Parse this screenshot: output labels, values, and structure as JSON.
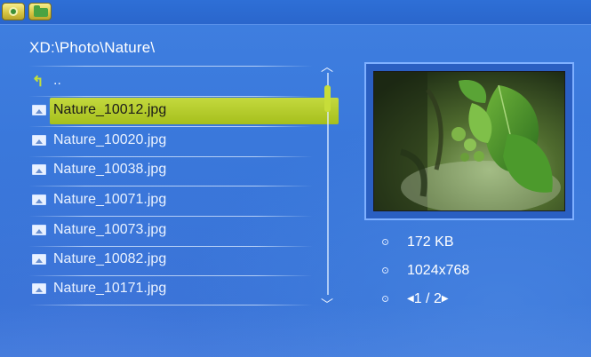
{
  "toolbar": {
    "icons": [
      "settings-icon",
      "folder-icon"
    ]
  },
  "browser": {
    "path": "XD:\\Photo\\Nature\\",
    "parent": "..",
    "files": [
      "Nature_10012.jpg",
      "Nature_10020.jpg",
      "Nature_10038.jpg",
      "Nature_10071.jpg",
      "Nature_10073.jpg",
      "Nature_10082.jpg",
      "Nature_10171.jpg"
    ],
    "selected_index": 0
  },
  "scrollbar": {
    "up_glyph": "^",
    "down_glyph": "v"
  },
  "info": {
    "size": "172 KB",
    "resolution": "1024x768",
    "page": "1 / 2",
    "page_prev": "◀",
    "page_next": "▶"
  },
  "colors": {
    "background": "#3a78db",
    "highlight": "#b8cf2c",
    "text": "#eaf2ff"
  }
}
